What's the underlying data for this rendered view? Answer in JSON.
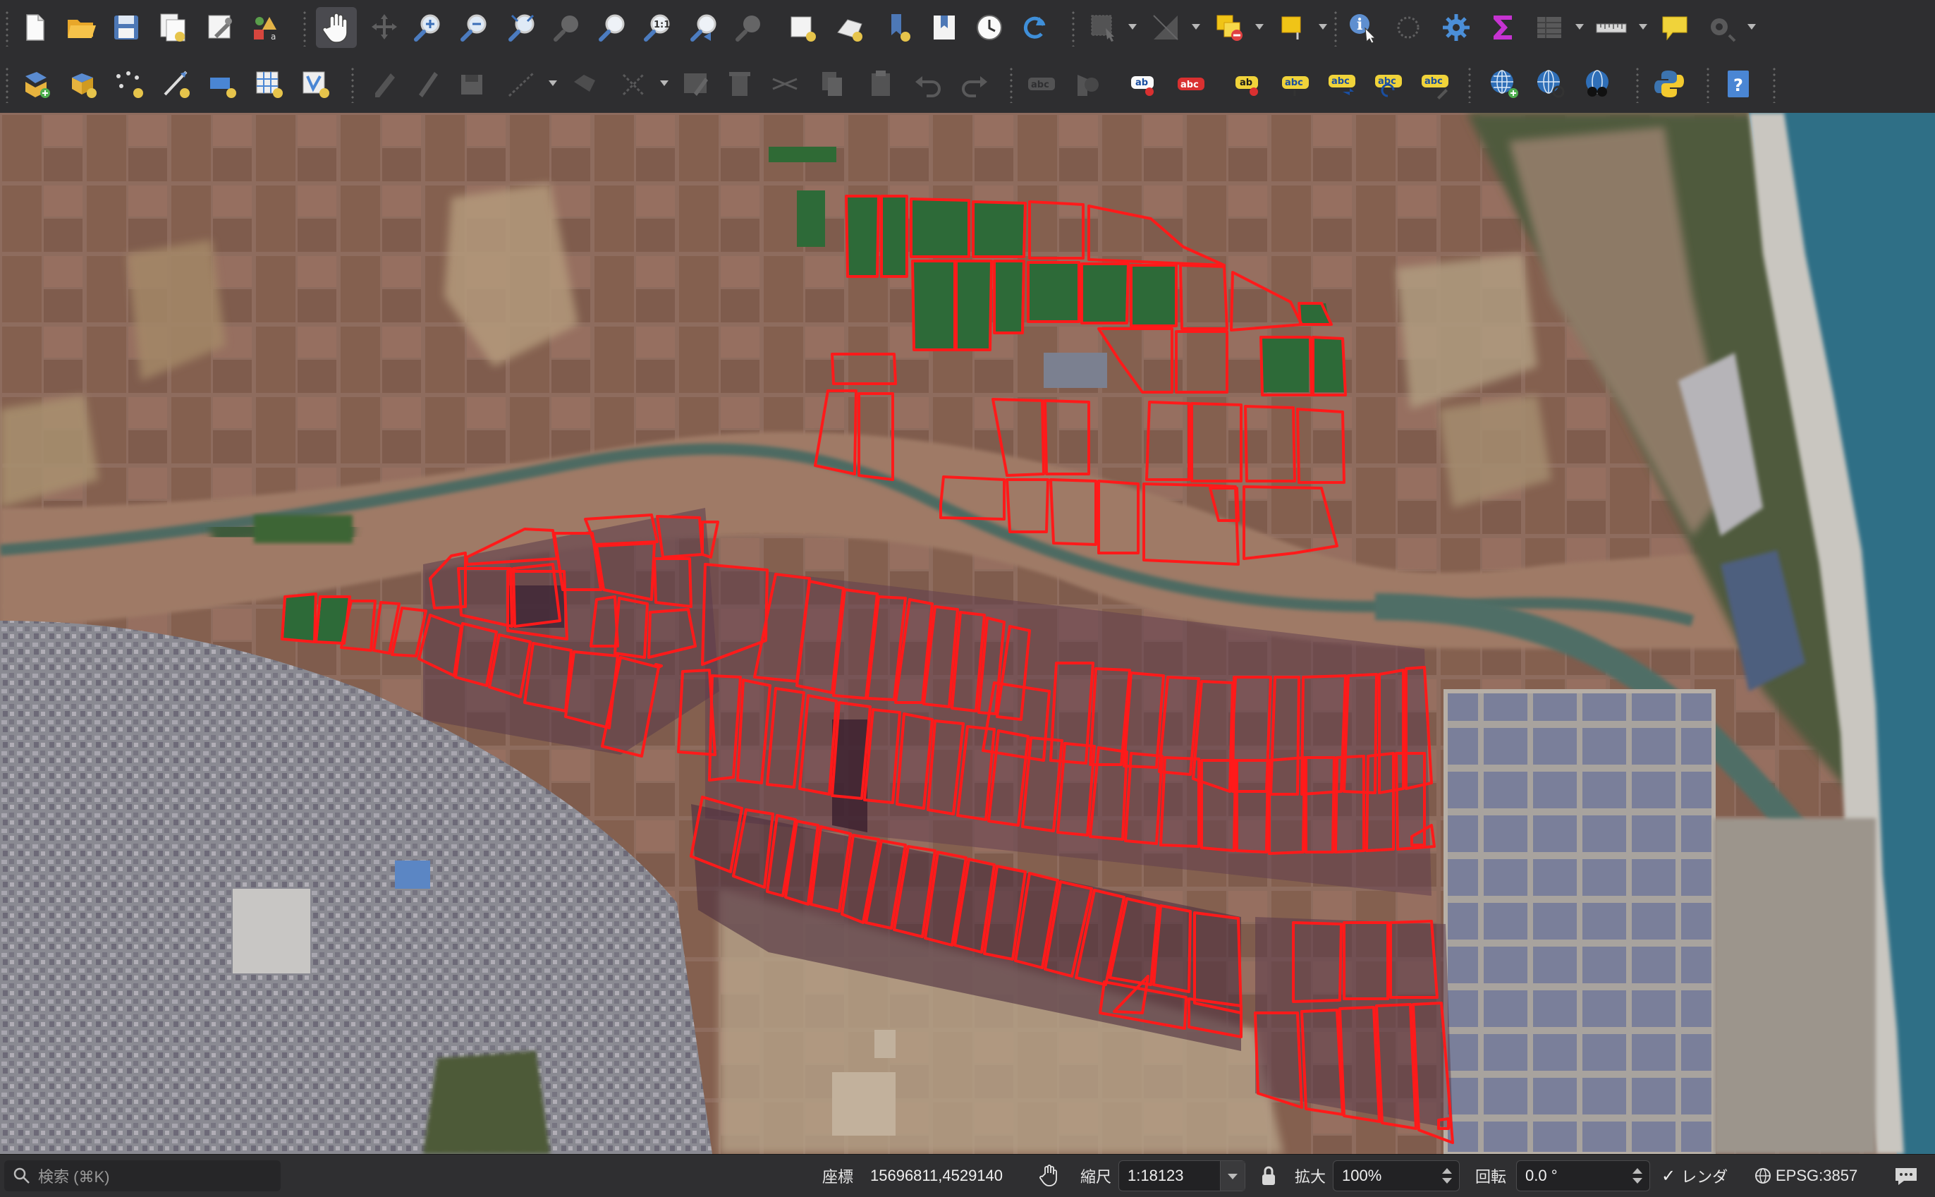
{
  "toolbar_primary": {
    "tools": [
      "new-project-icon",
      "open-project-icon",
      "save-project-icon",
      "new-print-layout-icon",
      "style-manager-icon",
      "pan-map-icon",
      "pan-to-selection-icon",
      "zoom-in-icon",
      "zoom-out-icon",
      "zoom-full-icon",
      "zoom-to-selection-icon",
      "zoom-to-layer-icon",
      "zoom-native-resolution-icon",
      "zoom-last-icon",
      "zoom-next-icon",
      "new-map-view-icon",
      "new-3d-map-view-icon",
      "new-bookmark-icon",
      "show-bookmarks-icon",
      "temporal-controller-icon",
      "refresh-icon",
      "select-features-icon",
      "deselect-features-icon",
      "select-by-expression-icon",
      "select-by-location-icon",
      "identify-features-icon",
      "open-attribute-table-icon",
      "processing-toolbox-icon",
      "statistical-summary-icon",
      "field-calculator-icon",
      "measure-line-icon",
      "map-tips-icon",
      "annotation-icon"
    ],
    "active_tool": "pan-map-icon"
  },
  "toolbar_secondary": {
    "label_buttons": [
      "ab",
      "abc",
      "ab",
      "abc",
      "abc",
      "abc",
      "abc"
    ],
    "help_label": "?"
  },
  "map": {
    "field_outline_color": "#ff1a1a",
    "river_color": "#4f6e66",
    "sea_color": "#2f6f86",
    "town_color": "#8a8a92",
    "solar_panel_color": "#7a7f9a"
  },
  "statusbar": {
    "search_placeholder": "検索 (⌘K)",
    "coordinate_label": "座標",
    "coordinate_value": "15696811,4529140",
    "scale_label": "縮尺",
    "scale_value": "1:18123",
    "magnifier_label": "拡大",
    "magnifier_value": "100%",
    "rotation_label": "回転",
    "rotation_value": "0.0 °",
    "render_label": "レンダ",
    "render_checked": true,
    "crs_label": "EPSG:3857"
  }
}
